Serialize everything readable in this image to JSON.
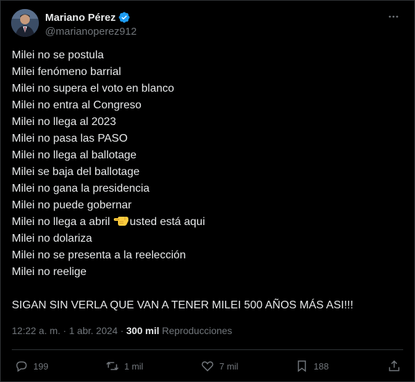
{
  "author": {
    "display_name": "Mariano Pérez",
    "handle": "@marianoperez912"
  },
  "tweet": {
    "lines": [
      "Milei no se postula",
      "Milei fenómeno barrial",
      "Milei no supera el voto en blanco",
      "Milei no entra al Congreso",
      "Milei no llega al 2023",
      "Milei no pasa las PASO",
      "Milei no llega al ballotage",
      "Milei se baja del ballotage",
      "Milei no gana la presidencia",
      "Milei no puede gobernar"
    ],
    "abril_line_before": "Milei no llega a abril ",
    "abril_line_after": "usted está aqui",
    "lines_after": [
      "Milei no dolariza",
      "Milei no se presenta a la reelección",
      "Milei no reelige"
    ],
    "closing": "SIGAN SIN VERLA QUE VAN A TENER MILEI 500 AÑOS MÁS ASI!!!"
  },
  "meta": {
    "time": "12:22 a. m.",
    "separator": " · ",
    "date": "1 abr. 2024",
    "views_count": "300 mil",
    "views_label": " Reproducciones"
  },
  "actions": {
    "replies": "199",
    "reposts": "1 mil",
    "likes": "7 mil",
    "bookmarks": "188"
  },
  "icons": {
    "verified": "verified-badge-icon",
    "more": "more-icon",
    "pointing": "backhand-index-pointing-left-emoji",
    "reply": "reply-icon",
    "repost": "repost-icon",
    "like": "heart-icon",
    "bookmark": "bookmark-icon",
    "share": "share-icon"
  },
  "colors": {
    "background": "#000000",
    "text": "#e7e9ea",
    "secondary": "#71767b",
    "border": "#2f3336",
    "verified": "#1d9bf0"
  }
}
